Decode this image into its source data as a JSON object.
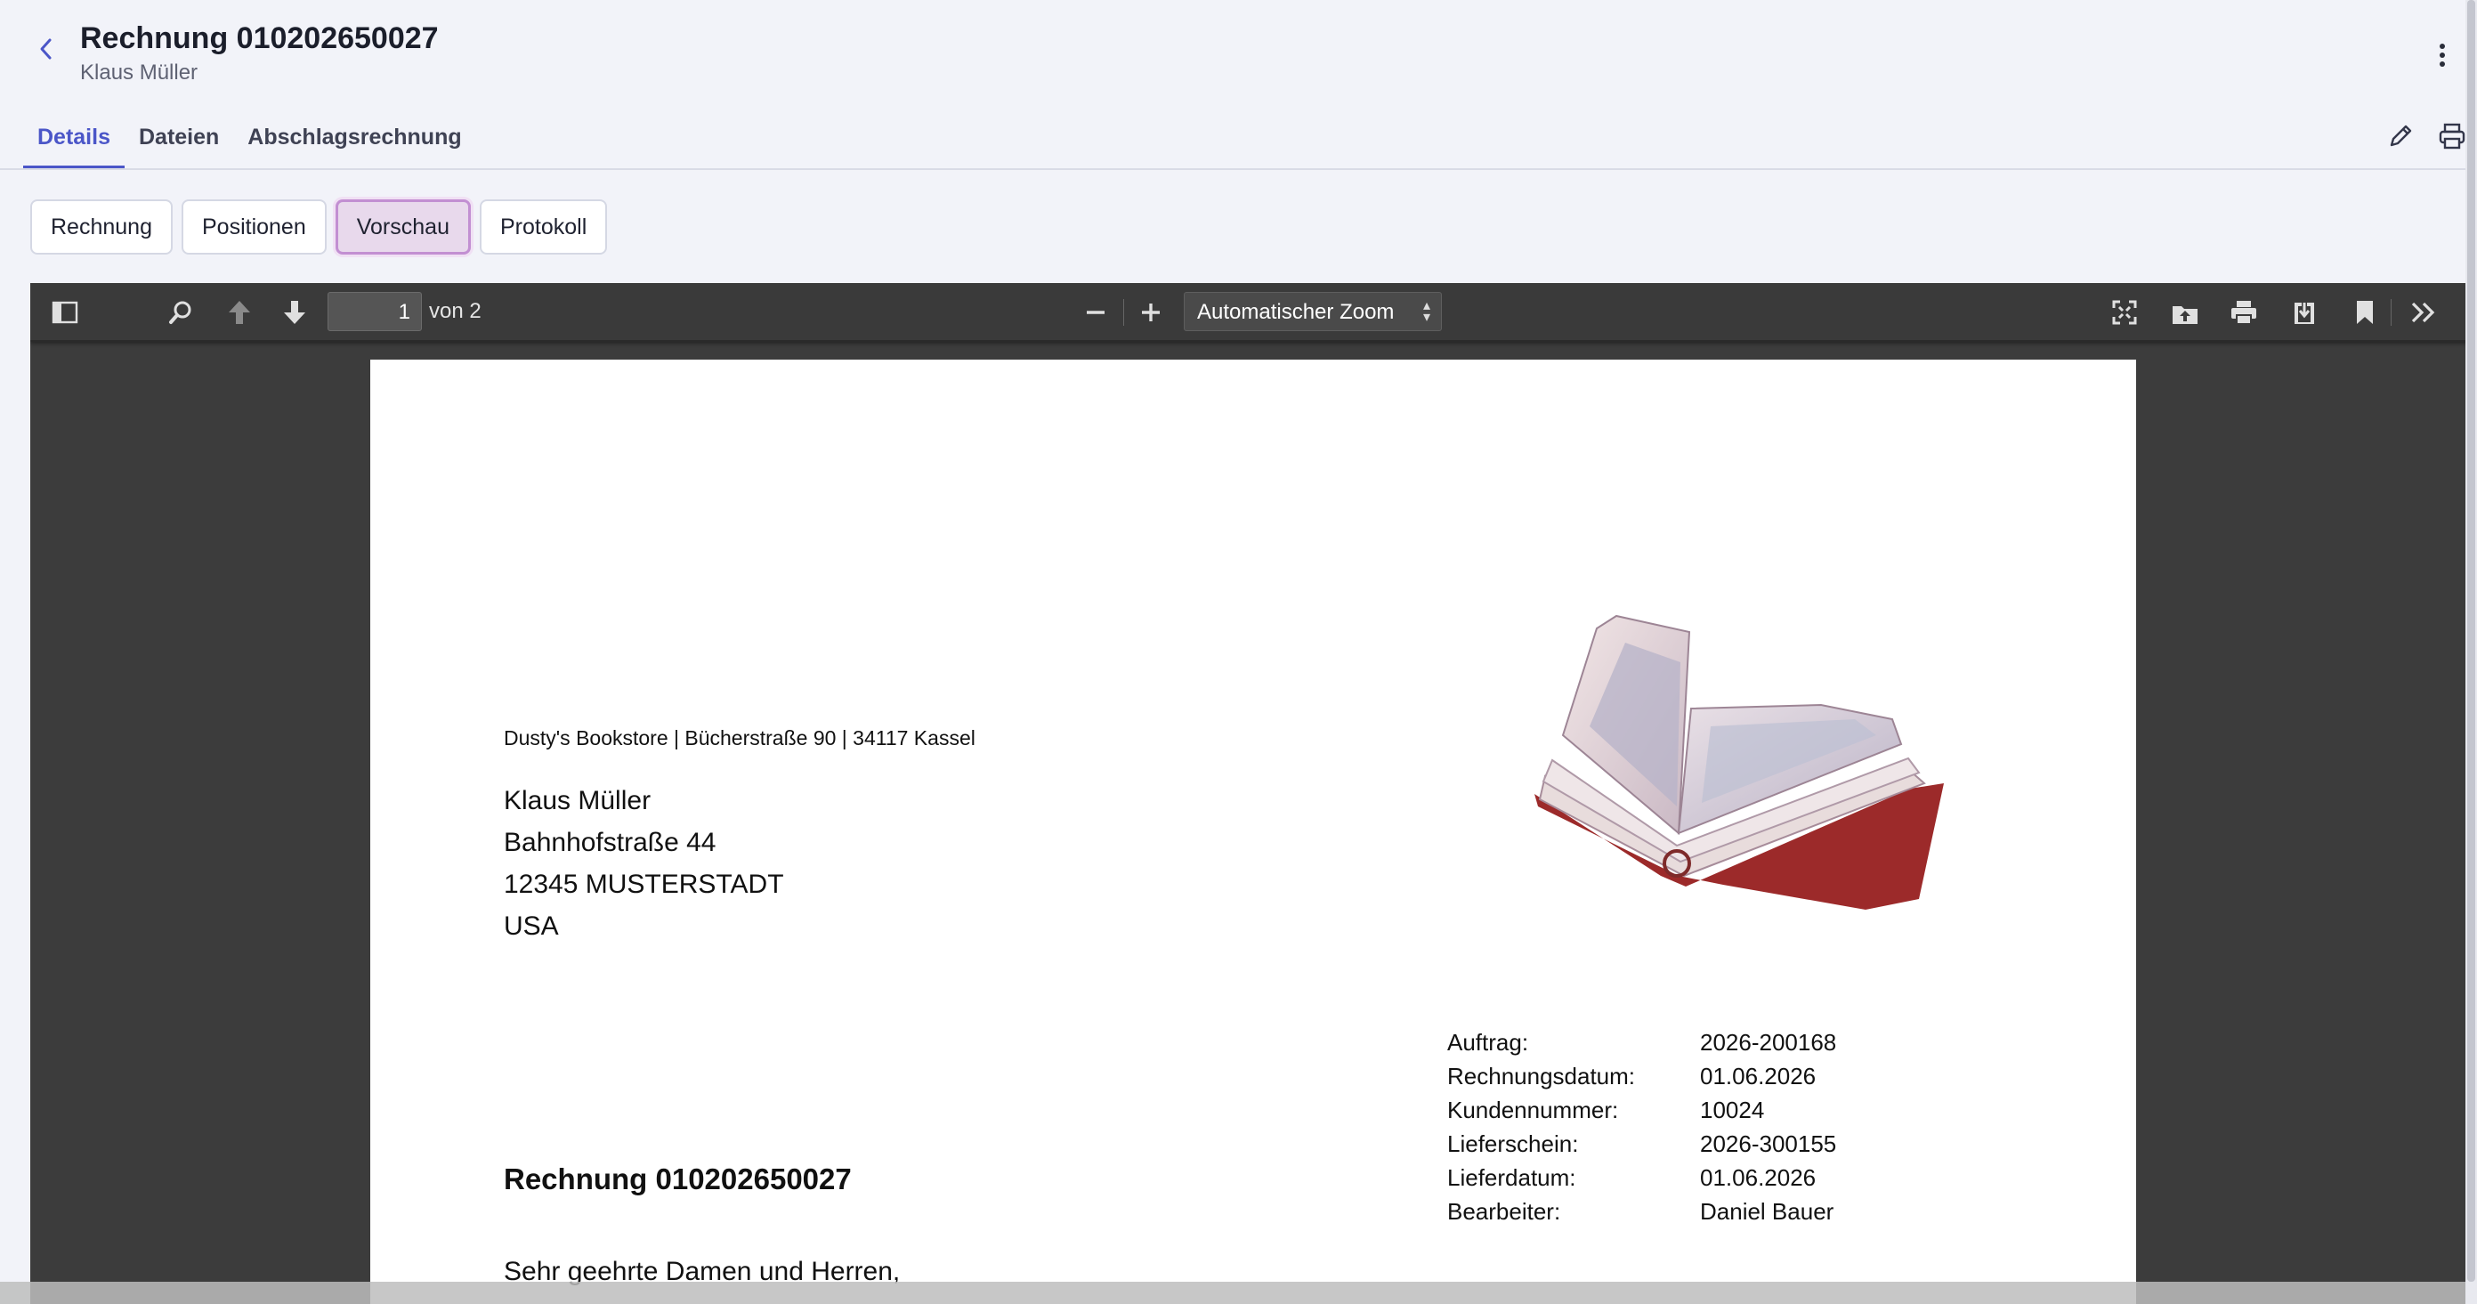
{
  "header": {
    "title": "Rechnung 010202650027",
    "subtitle": "Klaus Müller"
  },
  "tabs": [
    {
      "label": "Details",
      "active": true
    },
    {
      "label": "Dateien",
      "active": false
    },
    {
      "label": "Abschlagsrechnung",
      "active": false
    }
  ],
  "subnav": [
    {
      "label": "Rechnung",
      "active": false
    },
    {
      "label": "Positionen",
      "active": false
    },
    {
      "label": "Vorschau",
      "active": true
    },
    {
      "label": "Protokoll",
      "active": false
    }
  ],
  "viewer": {
    "page_current": "1",
    "page_of": "von 2",
    "zoom": "Automatischer Zoom"
  },
  "document": {
    "sender_line": "Dusty's Bookstore | Bücherstraße 90 | 34117 Kassel",
    "recipient": [
      "Klaus Müller",
      "Bahnhofstraße 44",
      "12345 MUSTERSTADT",
      "USA"
    ],
    "info": [
      {
        "key": "Auftrag:",
        "value": "2026-200168"
      },
      {
        "key": "Rechnungsdatum:",
        "value": "01.06.2026"
      },
      {
        "key": "Kundennummer:",
        "value": "10024"
      },
      {
        "key": "Lieferschein:",
        "value": "2026-300155"
      },
      {
        "key": "Lieferdatum:",
        "value": "01.06.2026"
      },
      {
        "key": "Bearbeiter:",
        "value": "Daniel Bauer"
      }
    ],
    "title": "Rechnung 010202650027",
    "salutation": "Sehr geehrte Damen und Herren,"
  },
  "colors": {
    "accent": "#4b56c8",
    "active_subnav_bg": "#e8d9ec",
    "viewer_bg": "#3c3c3c"
  }
}
